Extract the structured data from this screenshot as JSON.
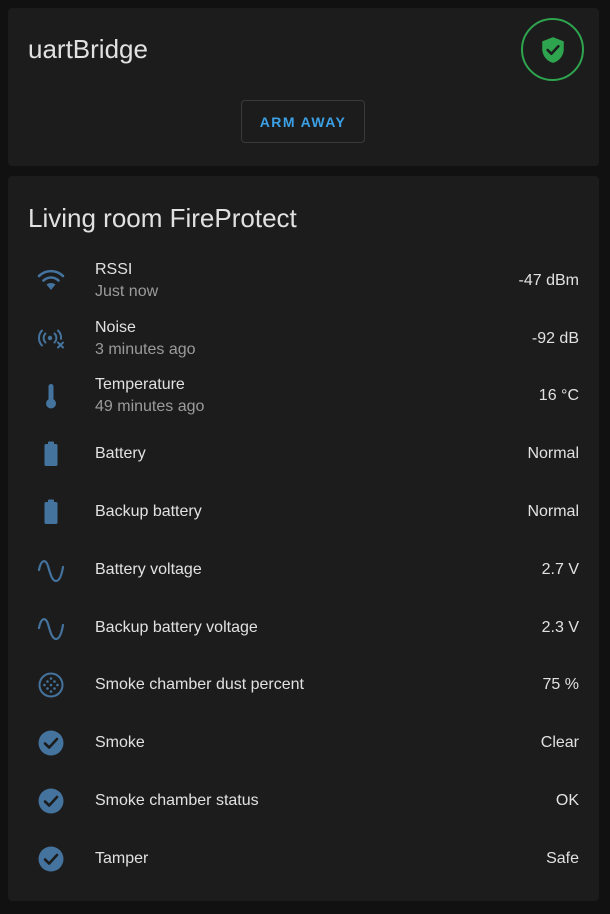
{
  "colors": {
    "background": "#111111",
    "card": "#1c1c1c",
    "icon": "#44739e",
    "armed_green": "#2ea44f",
    "button_text": "#3ba0e6"
  },
  "alarm_panel": {
    "title": "uartBridge",
    "state_icon": "shield-check-icon",
    "button_label": "ARM AWAY"
  },
  "entities_card": {
    "title": "Living room FireProtect",
    "rows": [
      {
        "icon": "wifi-icon",
        "name": "RSSI",
        "secondary": "Just now",
        "value": "-47 dBm"
      },
      {
        "icon": "radio-tower-off-icon",
        "name": "Noise",
        "secondary": "3 minutes ago",
        "value": "-92 dB"
      },
      {
        "icon": "thermometer-icon",
        "name": "Temperature",
        "secondary": "49 minutes ago",
        "value": "16 °C"
      },
      {
        "icon": "battery-icon",
        "name": "Battery",
        "secondary": "",
        "value": "Normal"
      },
      {
        "icon": "battery-icon",
        "name": "Backup battery",
        "secondary": "",
        "value": "Normal"
      },
      {
        "icon": "sine-wave-icon",
        "name": "Battery voltage",
        "secondary": "",
        "value": "2.7 V"
      },
      {
        "icon": "sine-wave-icon",
        "name": "Backup battery voltage",
        "secondary": "",
        "value": "2.3 V"
      },
      {
        "icon": "dots-circle-icon",
        "name": "Smoke chamber dust percent",
        "secondary": "",
        "value": "75 %"
      },
      {
        "icon": "check-circle-icon",
        "name": "Smoke",
        "secondary": "",
        "value": "Clear"
      },
      {
        "icon": "check-circle-icon",
        "name": "Smoke chamber status",
        "secondary": "",
        "value": "OK"
      },
      {
        "icon": "check-circle-icon",
        "name": "Tamper",
        "secondary": "",
        "value": "Safe"
      }
    ]
  }
}
